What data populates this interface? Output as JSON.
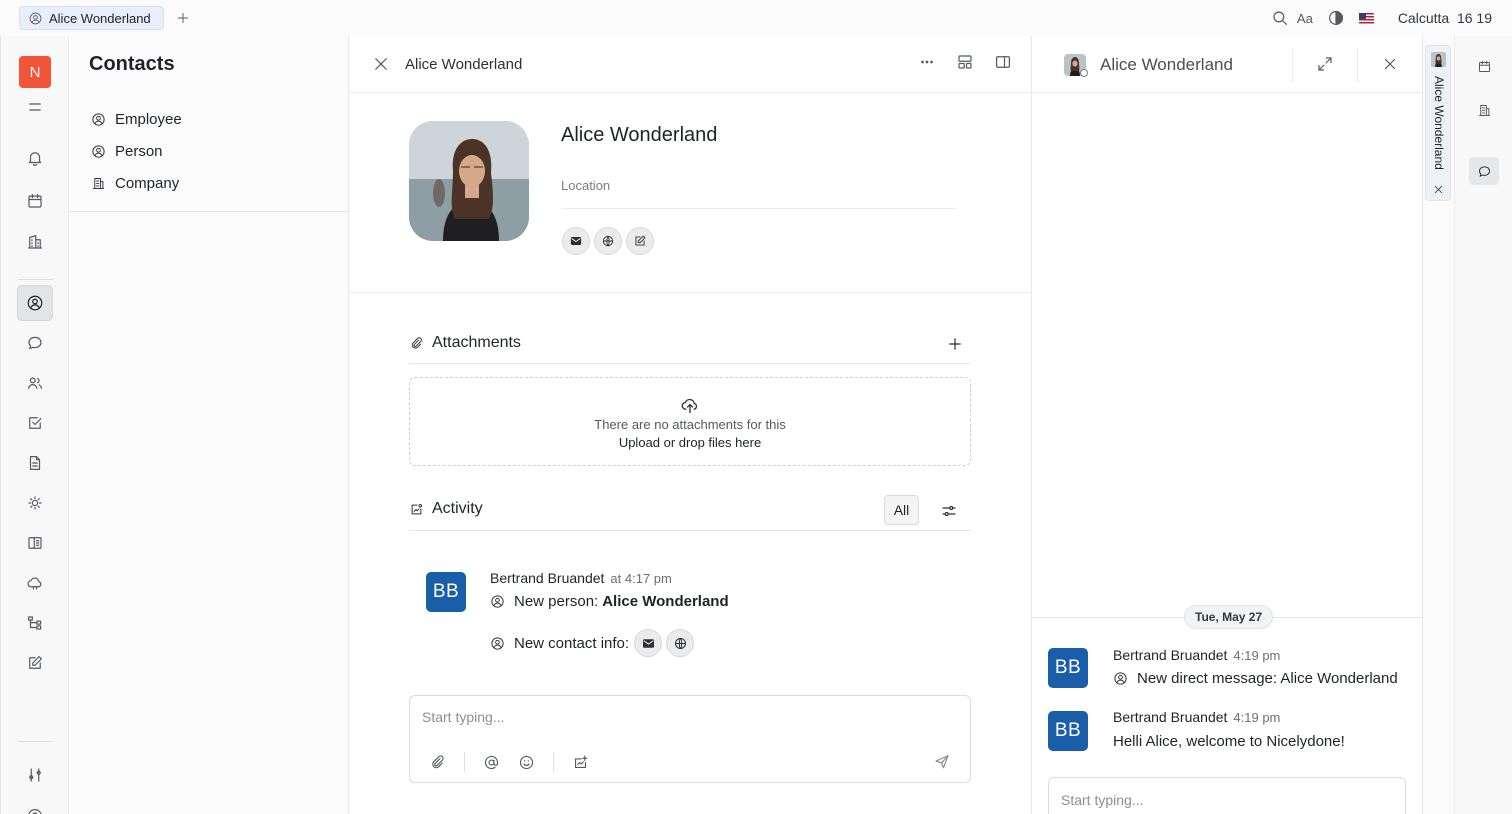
{
  "top_bar": {
    "tab_label": "Alice Wonderland",
    "font_size_label": "Aa",
    "city": "Calcutta",
    "time": "16 19",
    "flag_icon": "us-flag-icon"
  },
  "nav": {
    "logo_letter": "N",
    "accent_color": "#f0553a"
  },
  "sidebar": {
    "title": "Contacts",
    "items": [
      {
        "label": "Employee"
      },
      {
        "label": "Person"
      },
      {
        "label": "Company"
      }
    ]
  },
  "main": {
    "header_title": "Alice Wonderland",
    "profile": {
      "name": "Alice Wonderland",
      "location_placeholder": "Location"
    },
    "attachments": {
      "title": "Attachments",
      "empty_text": "There are no attachments for this",
      "upload_text": "Upload or drop files here"
    },
    "activity": {
      "title": "Activity",
      "filter_label": "All",
      "entry": {
        "avatar_initials": "BB",
        "author": "Bertrand Bruandet",
        "time": "at 4:17 pm",
        "line1_prefix": "New person:",
        "line1_value": "Alice Wonderland",
        "line2_prefix": "New contact info:"
      }
    },
    "composer_placeholder": "Start typing..."
  },
  "chat": {
    "title": "Alice Wonderland",
    "date_label": "Tue, May 27",
    "messages": [
      {
        "initials": "BB",
        "author": "Bertrand Bruandet",
        "time": "4:19 pm",
        "text": "New direct message: Alice Wonderland"
      },
      {
        "initials": "BB",
        "author": "Bertrand Bruandet",
        "time": "4:19 pm",
        "text": "Helli Alice, welcome to Nicelydone!"
      }
    ],
    "composer_placeholder": "Start typing...",
    "brand_color": "#1a5da8"
  },
  "side_tab": {
    "label": "Alice Wonderland"
  }
}
